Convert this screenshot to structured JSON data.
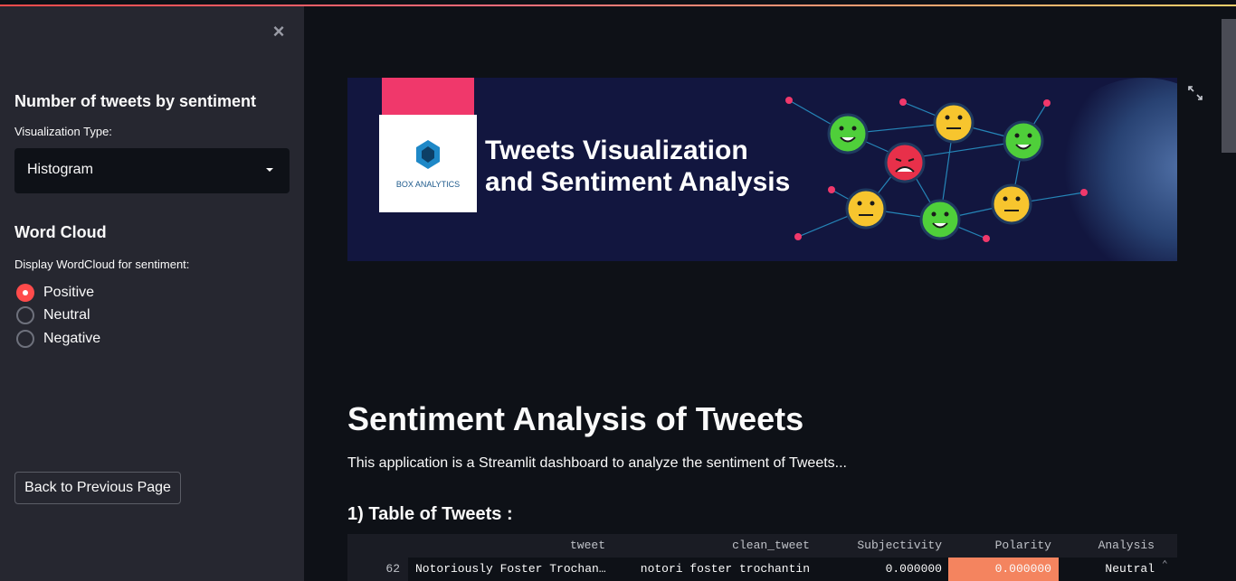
{
  "sidebar": {
    "close_icon": "×",
    "heading_tweets": "Number of tweets by sentiment",
    "viz_label": "Visualization Type:",
    "viz_selected": "Histogram",
    "heading_wordcloud": "Word Cloud",
    "wordcloud_label": "Display WordCloud for sentiment:",
    "radio_options": [
      "Positive",
      "Neutral",
      "Negative"
    ],
    "radio_selected": "Positive",
    "back_button": "Back to Previous Page"
  },
  "banner": {
    "brand": "BOX ANALYTICS",
    "title_line1": "Tweets Visualization",
    "title_line2": "and Sentiment Analysis"
  },
  "main": {
    "title": "Sentiment Analysis of Tweets",
    "description": "This application is a Streamlit dashboard to analyze the sentiment of Tweets...",
    "section_title": "1) Table of Tweets :"
  },
  "table": {
    "columns": [
      "tweet",
      "clean_tweet",
      "Subjectivity",
      "Polarity",
      "Analysis"
    ],
    "rows": [
      {
        "index": "62",
        "tweet": "Notoriously Foster Trochan…",
        "clean_tweet": "notori foster trochantin",
        "subjectivity": "0.000000",
        "polarity": "0.000000",
        "analysis": "Neutral"
      }
    ]
  },
  "colors": {
    "accent": "#ff4b4b",
    "sidebar_bg": "#262730",
    "main_bg": "#0e1117",
    "polarity_highlight": "#f4845f"
  }
}
